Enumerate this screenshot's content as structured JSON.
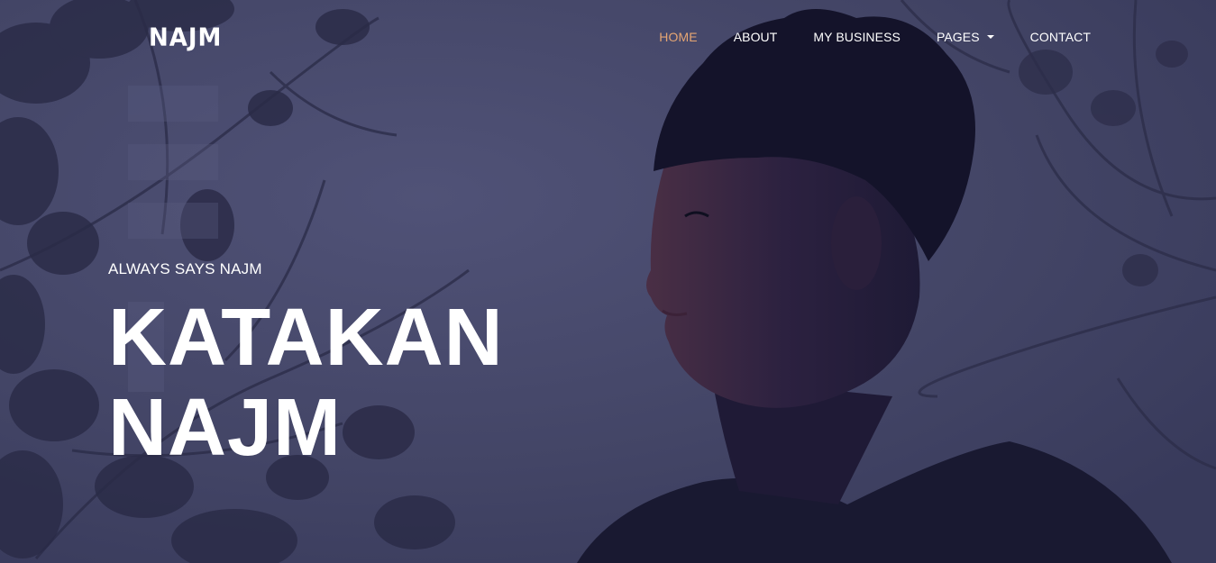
{
  "brand": {
    "logo_text": "NAJM"
  },
  "nav": {
    "items": [
      {
        "label": "HOME",
        "active": true
      },
      {
        "label": "ABOUT",
        "active": false
      },
      {
        "label": "MY BUSINESS",
        "active": false
      },
      {
        "label": "PAGES",
        "active": false,
        "dropdown": true
      },
      {
        "label": "CONTACT",
        "active": false
      }
    ]
  },
  "hero": {
    "subtitle": "ALWAYS SAYS NAJM",
    "headline_line1": "KATAKAN",
    "headline_line2": "NAJM",
    "background_image": "portrait-of-young-man-looking-left-with-tree-branches"
  },
  "colors": {
    "overlay": "#3c3d5e",
    "active_nav": "#e5a573",
    "text": "#ffffff"
  }
}
